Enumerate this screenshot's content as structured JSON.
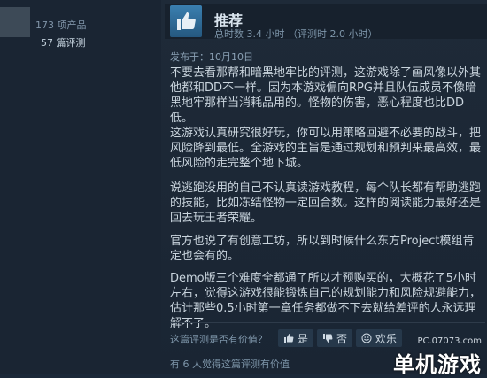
{
  "left": {
    "meta_products": "173 项产品",
    "meta_reviews": "57 篇评测"
  },
  "review": {
    "verdict": "推荐",
    "hours": "总时数 3.4 小时 （评测时 2.0 小时）",
    "posted": "发布于：10月10日",
    "paragraphs": [
      "不要去看那帮和暗黑地牢比的评测，这游戏除了画风像以外其他都和DD不一样。因为本游戏偏向RPG并且队伍成员不像暗黑地牢那样当消耗品用的。怪物的伤害，恶心程度也比DD低。",
      "这游戏认真研究很好玩，你可以用策略回避不必要的战斗，把风险降到最低。全游戏的主旨是通过规划和预判来最高效，最低风险的走完整个地下城。",
      "说逃跑没用的自己不认真读游戏教程，每个队长都有帮助逃跑的技能，比如冻结怪物一定回合数。这样的阅读能力最好还是回去玩王者荣耀。",
      "官方也说了有创意工坊，所以到时候什么东方Project模组肯定也会有的。",
      "Demo版三个难度全都通了所以才预购买的，大概花了5小时左右，觉得这游戏很能锻炼自己的规划能力和风险规避能力，估计那些0.5小时第一章任务都做不下去就给差评的人永远理解不了。"
    ]
  },
  "footer": {
    "question": "这篇评测是否有价值？",
    "yes": "是",
    "no": "否",
    "funny": "欢乐",
    "helpful_count": "有 6 人觉得这篇评测有价值"
  },
  "watermark": {
    "url": "PC.07073.com",
    "brand": "单机游戏"
  }
}
